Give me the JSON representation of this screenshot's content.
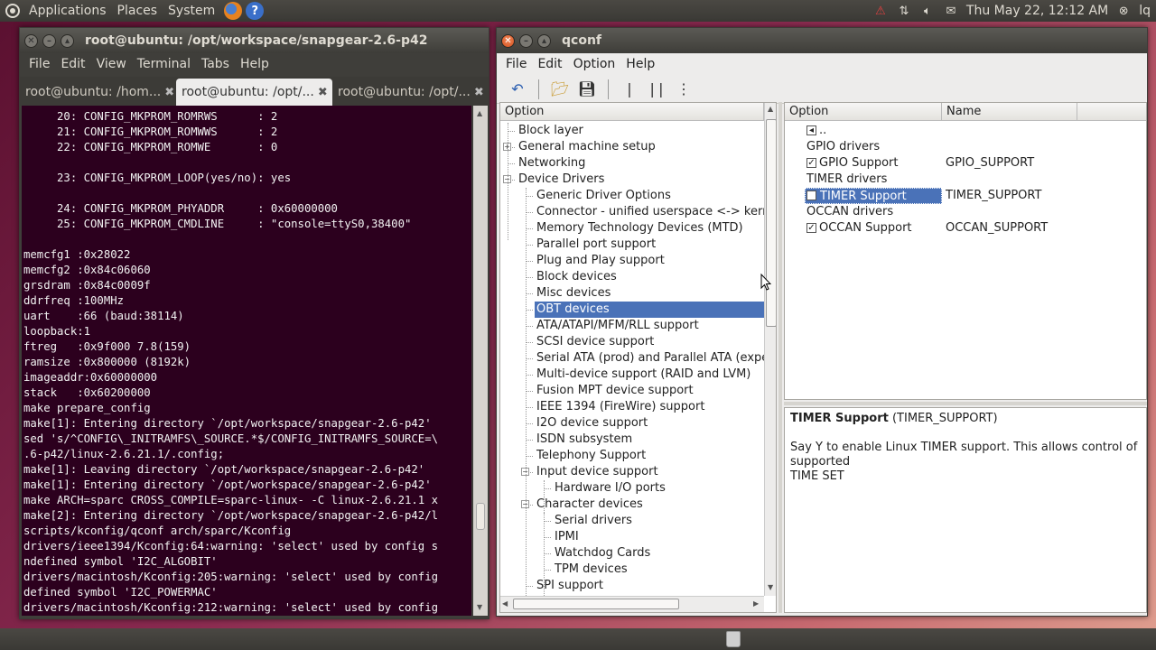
{
  "top_panel": {
    "menus": [
      "Applications",
      "Places",
      "System"
    ],
    "clock": "Thu May 22, 12:12 AM",
    "user": "lq"
  },
  "terminal": {
    "title": "root@ubuntu: /opt/workspace/snapgear-2.6-p42",
    "menu": [
      "File",
      "Edit",
      "View",
      "Terminal",
      "Tabs",
      "Help"
    ],
    "tabs": [
      {
        "label": "root@ubuntu: /hom..."
      },
      {
        "label": "root@ubuntu: /opt/..."
      },
      {
        "label": "root@ubuntu: /opt/..."
      }
    ],
    "lines": [
      "     20: CONFIG_MKPROM_ROMRWS      : 2",
      "     21: CONFIG_MKPROM_ROMWWS      : 2",
      "     22: CONFIG_MKPROM_ROMWE       : 0",
      "",
      "     23: CONFIG_MKPROM_LOOP(yes/no): yes",
      "",
      "     24: CONFIG_MKPROM_PHYADDR     : 0x60000000",
      "     25: CONFIG_MKPROM_CMDLINE     : \"console=ttyS0,38400\"",
      "",
      "memcfg1 :0x28022",
      "memcfg2 :0x84c06060",
      "grsdram :0x84c0009f",
      "ddrfreq :100MHz",
      "uart    :66 (baud:38114)",
      "loopback:1",
      "ftreg   :0x9f000 7.8(159)",
      "ramsize :0x800000 (8192k)",
      "imageaddr:0x60000000",
      "stack   :0x60200000",
      "make prepare_config",
      "make[1]: Entering directory `/opt/workspace/snapgear-2.6-p42'",
      "sed 's/^CONFIG\\_INITRAMFS\\_SOURCE.*$/CONFIG_INITRAMFS_SOURCE=\\",
      ".6-p42/linux-2.6.21.1/.config;",
      "make[1]: Leaving directory `/opt/workspace/snapgear-2.6-p42'",
      "make[1]: Entering directory `/opt/workspace/snapgear-2.6-p42'",
      "make ARCH=sparc CROSS_COMPILE=sparc-linux- -C linux-2.6.21.1 x",
      "make[2]: Entering directory `/opt/workspace/snapgear-2.6-p42/l",
      "scripts/kconfig/qconf arch/sparc/Kconfig",
      "drivers/ieee1394/Kconfig:64:warning: 'select' used by config s",
      "ndefined symbol 'I2C_ALGOBIT'",
      "drivers/macintosh/Kconfig:205:warning: 'select' used by config",
      "defined symbol 'I2C_POWERMAC'",
      "drivers/macintosh/Kconfig:212:warning: 'select' used by config"
    ]
  },
  "qconf": {
    "title": "qconf",
    "menu": [
      "File",
      "Edit",
      "Option",
      "Help"
    ],
    "tree_header": "Option",
    "tree": [
      {
        "label": "Block layer",
        "level": 0
      },
      {
        "label": "General machine setup",
        "level": 0,
        "expander": "+"
      },
      {
        "label": "Networking",
        "level": 0
      },
      {
        "label": "Device Drivers",
        "level": 0,
        "expander": "-"
      },
      {
        "label": "Generic Driver Options",
        "level": 1
      },
      {
        "label": "Connector - unified userspace <-> kernel",
        "level": 1
      },
      {
        "label": "Memory Technology Devices (MTD)",
        "level": 1
      },
      {
        "label": "Parallel port support",
        "level": 1
      },
      {
        "label": "Plug and Play support",
        "level": 1
      },
      {
        "label": "Block devices",
        "level": 1
      },
      {
        "label": "Misc devices",
        "level": 1
      },
      {
        "label": "OBT devices",
        "level": 1,
        "selected": true
      },
      {
        "label": "ATA/ATAPI/MFM/RLL support",
        "level": 1
      },
      {
        "label": "SCSI device support",
        "level": 1
      },
      {
        "label": "Serial ATA (prod) and Parallel ATA (experi",
        "level": 1
      },
      {
        "label": "Multi-device support (RAID and LVM)",
        "level": 1
      },
      {
        "label": "Fusion MPT device support",
        "level": 1
      },
      {
        "label": "IEEE 1394 (FireWire) support",
        "level": 1
      },
      {
        "label": "I2O device support",
        "level": 1
      },
      {
        "label": "ISDN subsystem",
        "level": 1
      },
      {
        "label": "Telephony Support",
        "level": 1
      },
      {
        "label": "Input device support",
        "level": 1,
        "expander": "-"
      },
      {
        "label": "Hardware I/O ports",
        "level": 2
      },
      {
        "label": "Character devices",
        "level": 1,
        "expander": "-"
      },
      {
        "label": "Serial drivers",
        "level": 2
      },
      {
        "label": "IPMI",
        "level": 2
      },
      {
        "label": "Watchdog Cards",
        "level": 2
      },
      {
        "label": "TPM devices",
        "level": 2
      },
      {
        "label": "SPI support",
        "level": 1
      }
    ],
    "options_headers": [
      "Option",
      "Name"
    ],
    "options": [
      {
        "label": "..",
        "name": "",
        "check": "up"
      },
      {
        "label": "GPIO drivers",
        "name": "",
        "check": "none"
      },
      {
        "label": "GPIO Support",
        "name": "GPIO_SUPPORT",
        "check": "checked"
      },
      {
        "label": "TIMER drivers",
        "name": "",
        "check": "none"
      },
      {
        "label": "TIMER Support",
        "name": "TIMER_SUPPORT",
        "check": "unchecked",
        "selected": true
      },
      {
        "label": "OCCAN drivers",
        "name": "",
        "check": "none"
      },
      {
        "label": "OCCAN Support",
        "name": "OCCAN_SUPPORT",
        "check": "checked"
      }
    ],
    "help": {
      "title": "TIMER Support",
      "symbol": "(TIMER_SUPPORT)",
      "line1": "Say Y to enable Linux TIMER support. This allows control of",
      "line2": "supported",
      "line3": "TIME SET"
    }
  },
  "colors": {
    "selection": "#4a72b8",
    "terminal_bg": "#2c001e",
    "panel": "#3c3b37"
  }
}
